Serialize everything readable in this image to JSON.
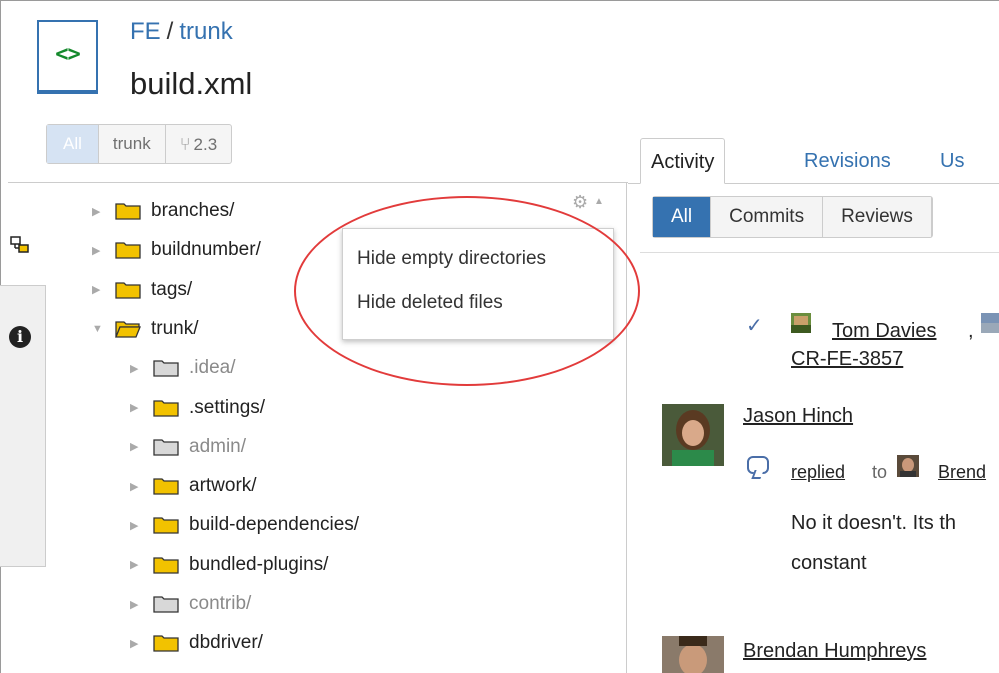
{
  "header": {
    "repo": "FE",
    "separator": "/",
    "branch": "trunk",
    "filename": "build.xml",
    "file_icon_glyph": "<>"
  },
  "branch_selector": {
    "all": "All",
    "trunk": "trunk",
    "version": "2.3"
  },
  "tree": [
    {
      "label": "branches/",
      "level": 0,
      "expanded": false,
      "empty": false
    },
    {
      "label": "buildnumber/",
      "level": 0,
      "expanded": false,
      "empty": false
    },
    {
      "label": "tags/",
      "level": 0,
      "expanded": false,
      "empty": false
    },
    {
      "label": "trunk/",
      "level": 0,
      "expanded": true,
      "empty": false
    },
    {
      "label": ".idea/",
      "level": 1,
      "expanded": false,
      "empty": true
    },
    {
      "label": ".settings/",
      "level": 1,
      "expanded": false,
      "empty": false
    },
    {
      "label": "admin/",
      "level": 1,
      "expanded": false,
      "empty": true
    },
    {
      "label": "artwork/",
      "level": 1,
      "expanded": false,
      "empty": false
    },
    {
      "label": "build-dependencies/",
      "level": 1,
      "expanded": false,
      "empty": false
    },
    {
      "label": "bundled-plugins/",
      "level": 1,
      "expanded": false,
      "empty": false
    },
    {
      "label": "contrib/",
      "level": 1,
      "expanded": false,
      "empty": true
    },
    {
      "label": "dbdriver/",
      "level": 1,
      "expanded": false,
      "empty": false
    }
  ],
  "dropdown": {
    "items": [
      "Hide empty directories",
      "Hide deleted files"
    ]
  },
  "right_tabs": [
    "Activity",
    "Revisions",
    "Us"
  ],
  "filters": [
    "All",
    "Commits",
    "Reviews"
  ],
  "activity": {
    "review_user": "Tom Davies",
    "review_comma": ",",
    "review_id": "CR-FE-3857",
    "author": "Jason Hinch",
    "replied": "replied",
    "to": "to",
    "reply_target": "Brend",
    "comment_line1": "No it doesn't. Its th",
    "comment_line2": "constant",
    "next_author": "Brendan Humphreys"
  },
  "colors": {
    "link": "#3572b0",
    "folder": "#f2c200",
    "folder_empty": "#d8d8d8",
    "annotation": "#e23b3b"
  }
}
